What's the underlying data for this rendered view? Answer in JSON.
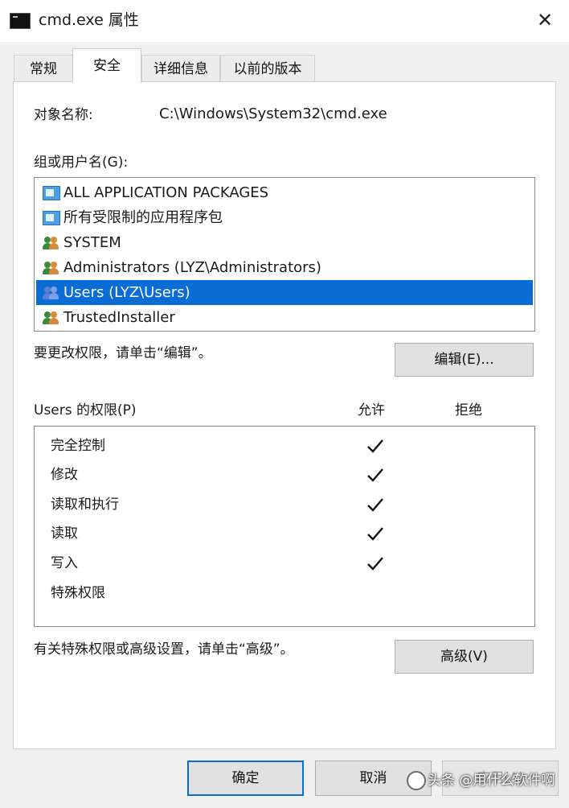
{
  "window": {
    "title": "cmd.exe 属性",
    "close_glyph": "✕",
    "app_icon": "terminal-icon"
  },
  "tabs": [
    {
      "label": "常规",
      "active": false
    },
    {
      "label": "安全",
      "active": true
    },
    {
      "label": "详细信息",
      "active": false
    },
    {
      "label": "以前的版本",
      "active": false
    }
  ],
  "object": {
    "label": "对象名称:",
    "value": "C:\\Windows\\System32\\cmd.exe"
  },
  "groups": {
    "label": "组或用户名(G):",
    "items": [
      {
        "name": "ALL APPLICATION PACKAGES",
        "icon": "package-icon",
        "selected": false
      },
      {
        "name": "所有受限制的应用程序包",
        "icon": "package-icon",
        "selected": false
      },
      {
        "name": "SYSTEM",
        "icon": "users-icon",
        "selected": false
      },
      {
        "name": "Administrators (LYZ\\Administrators)",
        "icon": "users-icon",
        "selected": false
      },
      {
        "name": "Users (LYZ\\Users)",
        "icon": "users-icon",
        "selected": true
      },
      {
        "name": "TrustedInstaller",
        "icon": "users-icon",
        "selected": false
      }
    ]
  },
  "change_hint": "要更改权限，请单击“编辑”。",
  "edit_button": "编辑(E)...",
  "permissions": {
    "label": "Users 的权限(P)",
    "allow_header": "允许",
    "deny_header": "拒绝",
    "rows": [
      {
        "name": "完全控制",
        "allow": true,
        "deny": false
      },
      {
        "name": "修改",
        "allow": true,
        "deny": false
      },
      {
        "name": "读取和执行",
        "allow": true,
        "deny": false
      },
      {
        "name": "读取",
        "allow": true,
        "deny": false
      },
      {
        "name": "写入",
        "allow": true,
        "deny": false
      },
      {
        "name": "特殊权限",
        "allow": false,
        "deny": false
      }
    ]
  },
  "advanced_hint": "有关特殊权限或高级设置，请单击“高级”。",
  "advanced_button": "高级(V)",
  "footer": {
    "ok": "确定",
    "cancel": "取消",
    "apply": "应用(A)"
  },
  "watermark": {
    "text": "头条 @用什么软件啊"
  },
  "colors": {
    "selection": "#0a6cd5",
    "window_bg": "#f0f0f0",
    "panel_bg": "#ffffff"
  }
}
